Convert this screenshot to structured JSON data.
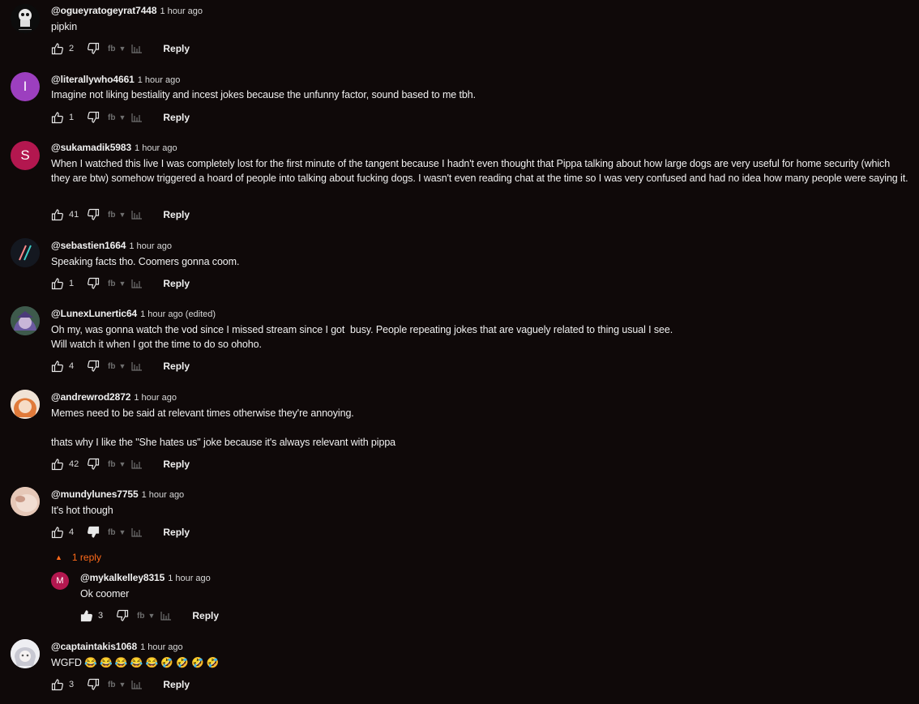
{
  "comments": [
    {
      "author": "@ogueyratogeyrat7448",
      "time": "1 hour ago",
      "text": "pipkin",
      "likes": "2",
      "reply_label": "Reply"
    },
    {
      "author": "@literallywho4661",
      "time": "1 hour ago",
      "text": "Imagine not liking bestiality and incest jokes because the unfunny factor, sound based to me tbh.",
      "likes": "1",
      "reply_label": "Reply",
      "avatar_letter": "I",
      "avatar_color": "#9c3fbf"
    },
    {
      "author": "@sukamadik5983",
      "time": "1 hour ago",
      "text": "When I watched this live I was completely lost for the first minute of the tangent because I hadn't even thought that Pippa talking about how large dogs are very useful for home security (which they are btw) somehow triggered a hoard of people into talking about fucking dogs. I wasn't even reading chat at the time so I was very confused and had no idea how many people were saying it.",
      "likes": "41",
      "reply_label": "Reply",
      "avatar_letter": "S",
      "avatar_color": "#b3174f"
    },
    {
      "author": "@sebastien1664",
      "time": "1 hour ago",
      "text": "Speaking facts tho. Coomers gonna coom.",
      "likes": "1",
      "reply_label": "Reply"
    },
    {
      "author": "@LunexLunertic64",
      "time": "1 hour ago (edited)",
      "text": "Oh my, was gonna watch the vod since I missed stream since I got  busy. People repeating jokes that are vaguely related to thing usual I see.\nWill watch it when I got the time to do so ohoho.",
      "likes": "4",
      "reply_label": "Reply"
    },
    {
      "author": "@andrewrod2872",
      "time": "1 hour ago",
      "text": "Memes need to be said at relevant times otherwise they're annoying.\n\nthats why I like the \"She hates us\" joke because it's always relevant with pippa",
      "likes": "42",
      "reply_label": "Reply"
    },
    {
      "author": "@mundylunes7755",
      "time": "1 hour ago",
      "text": "It's hot though",
      "likes": "4",
      "reply_label": "Reply",
      "replies_toggle": "1 reply"
    },
    {
      "author": "@mykalkelley8315",
      "time": "1 hour ago",
      "text": "Ok coomer",
      "likes": "3",
      "reply_label": "Reply",
      "avatar_letter": "M",
      "avatar_color": "#b3174f"
    },
    {
      "author": "@captaintakis1068",
      "time": "1 hour ago",
      "text": "WGFD 😂 😂 😂 😂 😂 🤣 🤣 🤣 🤣",
      "likes": "3",
      "reply_label": "Reply"
    }
  ],
  "colors": {
    "accent": "#ff6a1a",
    "background": "#0f0909"
  }
}
